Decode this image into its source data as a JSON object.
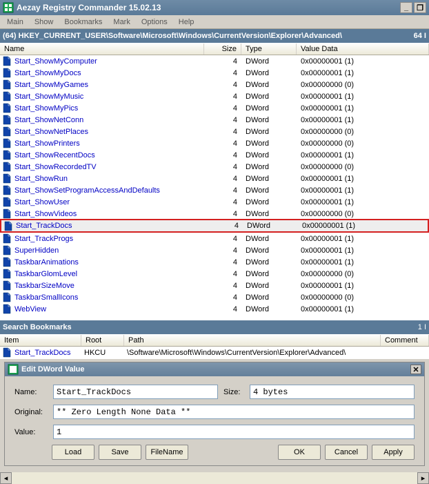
{
  "title": "Aezay Registry Commander 15.02.13",
  "menu": [
    "Main",
    "Show",
    "Bookmarks",
    "Mark",
    "Options",
    "Help"
  ],
  "path": {
    "count": "(64)",
    "text": "HKEY_CURRENT_USER\\Software\\Microsoft\\Windows\\CurrentVersion\\Explorer\\Advanced\\",
    "right": "64 I"
  },
  "headers": {
    "name": "Name",
    "size": "Size",
    "type": "Type",
    "value": "Value Data"
  },
  "rows": [
    {
      "name": "Start_ShowMyComputer",
      "size": "4",
      "type": "DWord",
      "value": "0x00000001 (1)"
    },
    {
      "name": "Start_ShowMyDocs",
      "size": "4",
      "type": "DWord",
      "value": "0x00000001 (1)"
    },
    {
      "name": "Start_ShowMyGames",
      "size": "4",
      "type": "DWord",
      "value": "0x00000000 (0)"
    },
    {
      "name": "Start_ShowMyMusic",
      "size": "4",
      "type": "DWord",
      "value": "0x00000001 (1)"
    },
    {
      "name": "Start_ShowMyPics",
      "size": "4",
      "type": "DWord",
      "value": "0x00000001 (1)"
    },
    {
      "name": "Start_ShowNetConn",
      "size": "4",
      "type": "DWord",
      "value": "0x00000001 (1)"
    },
    {
      "name": "Start_ShowNetPlaces",
      "size": "4",
      "type": "DWord",
      "value": "0x00000000 (0)"
    },
    {
      "name": "Start_ShowPrinters",
      "size": "4",
      "type": "DWord",
      "value": "0x00000000 (0)"
    },
    {
      "name": "Start_ShowRecentDocs",
      "size": "4",
      "type": "DWord",
      "value": "0x00000001 (1)"
    },
    {
      "name": "Start_ShowRecordedTV",
      "size": "4",
      "type": "DWord",
      "value": "0x00000000 (0)"
    },
    {
      "name": "Start_ShowRun",
      "size": "4",
      "type": "DWord",
      "value": "0x00000001 (1)"
    },
    {
      "name": "Start_ShowSetProgramAccessAndDefaults",
      "size": "4",
      "type": "DWord",
      "value": "0x00000001 (1)"
    },
    {
      "name": "Start_ShowUser",
      "size": "4",
      "type": "DWord",
      "value": "0x00000001 (1)"
    },
    {
      "name": "Start_ShowVideos",
      "size": "4",
      "type": "DWord",
      "value": "0x00000000 (0)"
    },
    {
      "name": "Start_TrackDocs",
      "size": "4",
      "type": "DWord",
      "value": "0x00000001 (1)",
      "hl": true
    },
    {
      "name": "Start_TrackProgs",
      "size": "4",
      "type": "DWord",
      "value": "0x00000001 (1)"
    },
    {
      "name": "SuperHidden",
      "size": "4",
      "type": "DWord",
      "value": "0x00000001 (1)"
    },
    {
      "name": "TaskbarAnimations",
      "size": "4",
      "type": "DWord",
      "value": "0x00000001 (1)"
    },
    {
      "name": "TaskbarGlomLevel",
      "size": "4",
      "type": "DWord",
      "value": "0x00000000 (0)"
    },
    {
      "name": "TaskbarSizeMove",
      "size": "4",
      "type": "DWord",
      "value": "0x00000001 (1)"
    },
    {
      "name": "TaskbarSmallIcons",
      "size": "4",
      "type": "DWord",
      "value": "0x00000000 (0)"
    },
    {
      "name": "WebView",
      "size": "4",
      "type": "DWord",
      "value": "0x00000001 (1)"
    }
  ],
  "search": {
    "title": "Search Bookmarks",
    "count": "1 I",
    "headers": {
      "item": "Item",
      "root": "Root",
      "path": "Path",
      "comment": "Comment"
    },
    "row": {
      "item": "Start_TrackDocs",
      "root": "HKCU",
      "path": "\\Software\\Microsoft\\Windows\\CurrentVersion\\Explorer\\Advanced\\"
    }
  },
  "dialog": {
    "title": "Edit DWord Value",
    "labels": {
      "name": "Name:",
      "original": "Original:",
      "value": "Value:",
      "size": "Size:"
    },
    "name": "Start_TrackDocs",
    "size": "4 bytes",
    "original": "** Zero Length None Data **",
    "value": "1",
    "buttons": {
      "load": "Load",
      "save": "Save",
      "filename": "FileName",
      "ok": "OK",
      "cancel": "Cancel",
      "apply": "Apply"
    }
  }
}
